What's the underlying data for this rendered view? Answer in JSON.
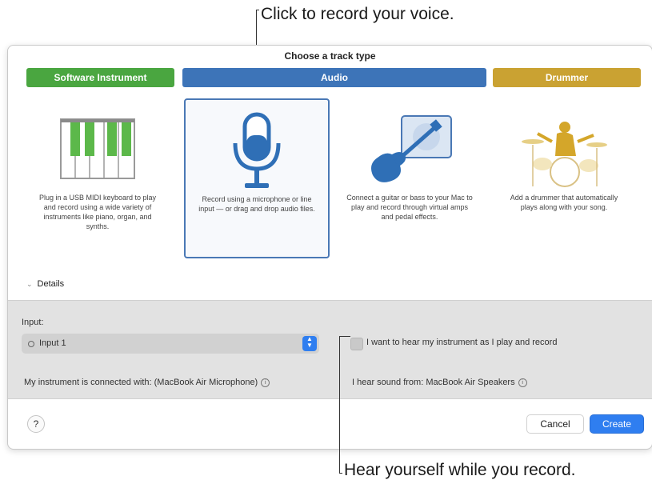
{
  "callouts": {
    "top": "Click to record your voice.",
    "bottom": "Hear yourself while you record."
  },
  "dialog": {
    "title": "Choose a track type",
    "categories": {
      "software": "Software Instrument",
      "audio": "Audio",
      "drummer": "Drummer"
    },
    "tiles": [
      {
        "icon": "keyboard-icon",
        "text": "Plug in a USB MIDI keyboard to play and record using a wide variety of instruments like piano, organ, and synths."
      },
      {
        "icon": "microphone-icon",
        "text": "Record using a microphone or line input — or drag and drop audio files."
      },
      {
        "icon": "guitar-icon",
        "text": "Connect a guitar or bass to your Mac to play and record through virtual amps and pedal effects."
      },
      {
        "icon": "drummer-icon",
        "text": "Add a drummer that automatically plays along with your song."
      }
    ],
    "selected_tile": 1,
    "details_label": "Details",
    "input_label": "Input:",
    "input_value": "Input 1",
    "monitor_label": "I want to hear my instrument as I play and record",
    "connected_with": "My instrument is connected with: (MacBook Air Microphone)",
    "hear_from": "I hear sound from: MacBook Air Speakers",
    "help_label": "?",
    "cancel_label": "Cancel",
    "create_label": "Create"
  },
  "colors": {
    "software": "#4aa640",
    "audio": "#3d74b8",
    "drummer": "#caa232",
    "accent": "#2f7ef0"
  }
}
